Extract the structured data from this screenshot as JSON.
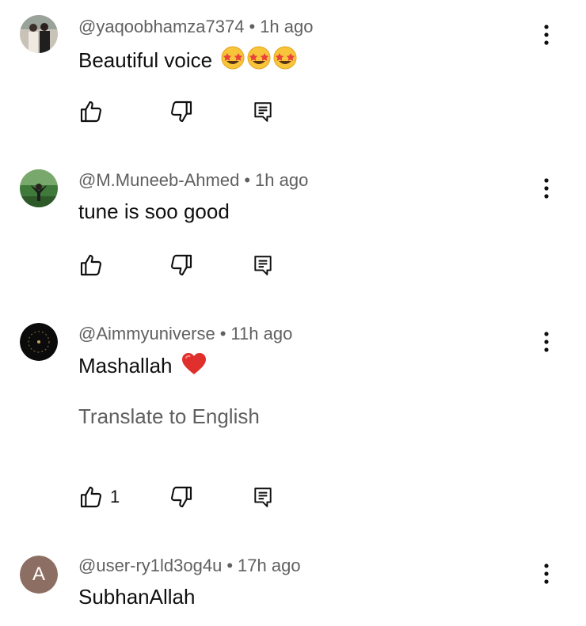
{
  "comments": [
    {
      "author": "@yaqoobhamza7374",
      "time": "1h ago",
      "text": "Beautiful voice",
      "emojis": [
        "star-struck",
        "star-struck",
        "star-struck"
      ],
      "likes": ""
    },
    {
      "author": "@M.Muneeb-Ahmed",
      "time": "1h ago",
      "text": "tune is soo good",
      "likes": ""
    },
    {
      "author": "@Aimmyuniverse",
      "time": "11h ago",
      "text": "Mashallah",
      "emojis": [
        "red-heart"
      ],
      "translate": "Translate to English",
      "likes": "1"
    },
    {
      "author": "@user-ry1ld3og4u",
      "time": "17h ago",
      "text": "SubhanAllah",
      "avatar_letter": "A",
      "likes": ""
    }
  ],
  "separator": "•",
  "colors": {
    "primary_text": "#0f0f0f",
    "secondary_text": "#606060",
    "letter_avatar_bg": "#8d6e63"
  }
}
